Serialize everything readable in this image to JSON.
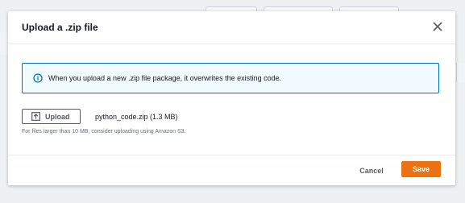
{
  "modal": {
    "title": "Upload a .zip file",
    "close_icon": "close-icon"
  },
  "info": {
    "icon": "info-icon",
    "message": "When you upload a new .zip file package, it overwrites the existing code."
  },
  "upload": {
    "button_label": "Upload",
    "icon": "upload-icon",
    "file_name": "python_code.zip (1.3 MB)",
    "hint": "For files larger than 10 MB, consider uploading using Amazon S3."
  },
  "footer": {
    "cancel_label": "Cancel",
    "save_label": "Save"
  },
  "colors": {
    "accent": "#ec7211",
    "info_border": "#0073bb",
    "info_bg": "#f1faff"
  }
}
